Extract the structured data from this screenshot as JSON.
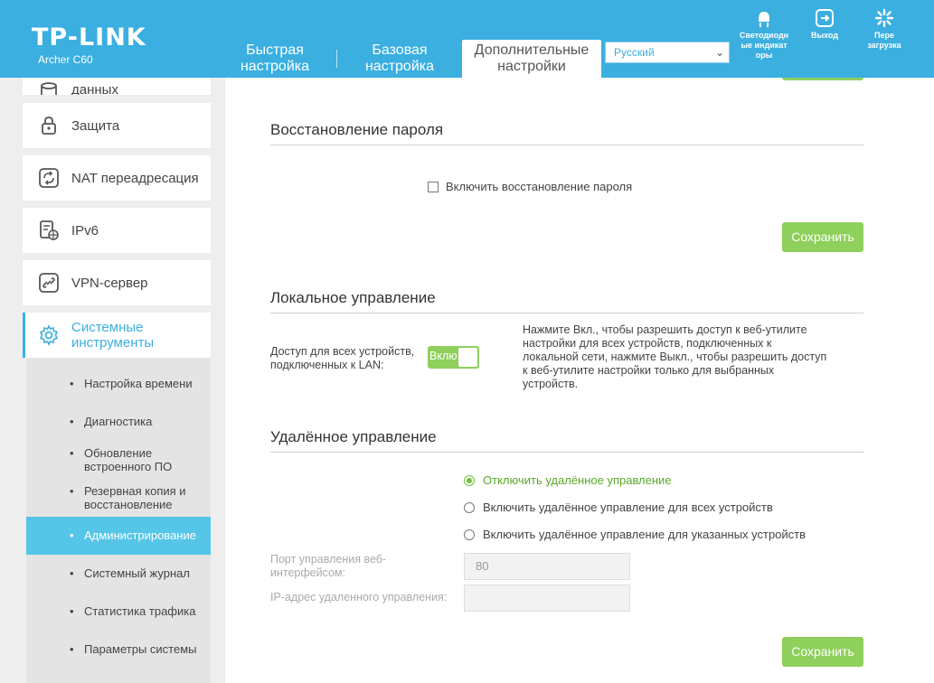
{
  "header": {
    "logo": "TP-LINK",
    "model": "Archer C60",
    "tabs": [
      {
        "label_line1": "Быстрая",
        "label_line2": "настройка"
      },
      {
        "label_line1": "Базовая",
        "label_line2": "настройка"
      },
      {
        "label_line1": "Дополнительные",
        "label_line2": "настройки"
      }
    ],
    "language": "Русский",
    "buttons": {
      "led_line1": "Светодиодн",
      "led_line2": "ые индикат",
      "led_line3": "оры",
      "logout": "Выход",
      "reboot_line1": "Пере",
      "reboot_line2": "загрузка"
    }
  },
  "sidebar": {
    "items": [
      {
        "label": "данных",
        "icon": "database-icon"
      },
      {
        "label": "Защита",
        "icon": "lock-icon"
      },
      {
        "label": "NAT переадресация",
        "icon": "nat-forwarding-icon"
      },
      {
        "label": "IPv6",
        "icon": "ipv6-icon"
      },
      {
        "label": "VPN-сервер",
        "icon": "vpn-icon"
      },
      {
        "label_line1": "Системные",
        "label_line2": "инструменты",
        "icon": "gear-icon"
      }
    ],
    "submenu": [
      {
        "label": "Настройка времени"
      },
      {
        "label": "Диагностика"
      },
      {
        "label_line1": "Обновление",
        "label_line2": "встроенного ПО"
      },
      {
        "label_line1": "Резервная копия и",
        "label_line2": "восстановление"
      },
      {
        "label": "Администрирование"
      },
      {
        "label": "Системный журнал"
      },
      {
        "label": "Статистика трафика"
      },
      {
        "label": "Параметры системы"
      }
    ]
  },
  "password_recovery": {
    "title": "Восстановление пароля",
    "checkbox_label": "Включить восстановление пароля",
    "checkbox_checked": false,
    "save": "Сохранить"
  },
  "local_management": {
    "title": "Локальное управление",
    "label_line1": "Доступ для всех устройств,",
    "label_line2": "подключенных к LAN:",
    "toggle_label": "Вклю",
    "toggle_on": true,
    "help_line1": "Нажмите Вкл., чтобы разрешить доступ к веб-утилите",
    "help_line2": "настройки для всех устройств, подключенных к",
    "help_line3": "локальной сети, нажмите Выкл., чтобы разрешить доступ",
    "help_line4": "к веб-утилите настройки только для выбранных",
    "help_line5": "устройств."
  },
  "remote_management": {
    "title": "Удалённое управление",
    "options": [
      {
        "label": "Отключить удалённое управление",
        "selected": true
      },
      {
        "label": "Включить удалённое управление для всех устройств",
        "selected": false
      },
      {
        "label": "Включить удалённое управление для указанных устройств",
        "selected": false
      }
    ],
    "port_label_line1": "Порт управления веб-",
    "port_label_line2": "интерфейсом:",
    "port_value": "80",
    "ip_label": "IP-адрес удаленного управления:",
    "ip_value": "",
    "save": "Сохранить"
  },
  "colors": {
    "header_blue": "#3aafe0",
    "save_green": "#8fcf5c",
    "submenu_active": "#55c5e8"
  }
}
